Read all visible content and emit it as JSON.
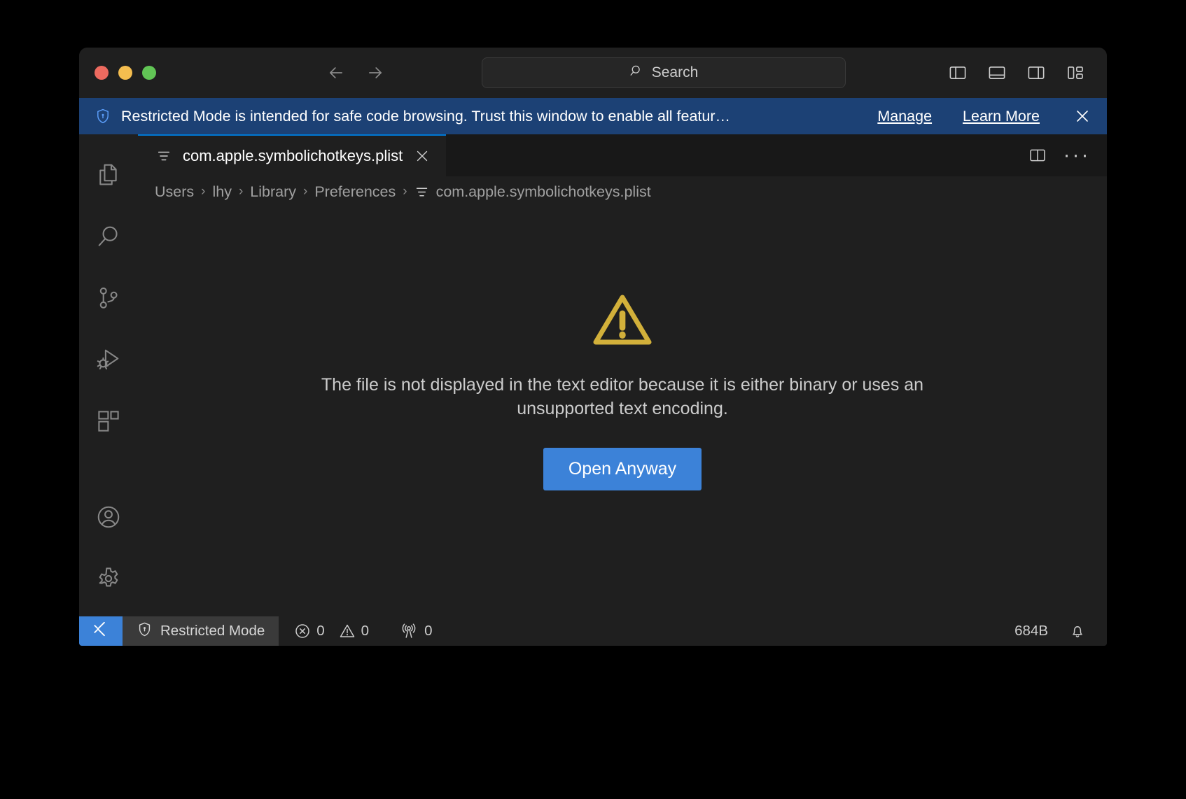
{
  "titlebar": {
    "traffic": [
      "close",
      "minimize",
      "maximize"
    ],
    "back_label": "Back",
    "forward_label": "Forward",
    "search_placeholder": "Search",
    "search_value": "Search",
    "layout_buttons": [
      "toggle-primary-sidebar",
      "toggle-panel",
      "toggle-secondary-sidebar",
      "customize-layout"
    ]
  },
  "banner": {
    "icon": "shield-icon",
    "message": "Restricted Mode is intended for safe code browsing. Trust this window to enable all featur…",
    "manage_label": "Manage",
    "learn_more_label": "Learn More",
    "close_label": "Close"
  },
  "activitybar": {
    "items": [
      {
        "name": "explorer",
        "icon": "files-icon"
      },
      {
        "name": "search",
        "icon": "search-icon"
      },
      {
        "name": "source-control",
        "icon": "source-control-icon"
      },
      {
        "name": "run-and-debug",
        "icon": "debug-icon"
      },
      {
        "name": "extensions",
        "icon": "extensions-icon"
      }
    ],
    "bottom_items": [
      {
        "name": "accounts",
        "icon": "account-icon"
      },
      {
        "name": "manage",
        "icon": "gear-icon"
      }
    ]
  },
  "editor": {
    "tab": {
      "icon": "file-list-icon",
      "label": "com.apple.symbolichotkeys.plist",
      "close_label": "Close tab",
      "active": true
    },
    "tab_actions": [
      "split-editor-icon",
      "more-actions-icon"
    ],
    "more_actions_glyph": "···",
    "breadcrumbs": [
      {
        "label": "Users",
        "icon": null
      },
      {
        "label": "lhy",
        "icon": null
      },
      {
        "label": "Library",
        "icon": null
      },
      {
        "label": "Preferences",
        "icon": null
      },
      {
        "label": "com.apple.symbolichotkeys.plist",
        "icon": "file-list-icon"
      }
    ],
    "breadcrumb_separator": "›",
    "warning_icon": "warning-triangle-icon",
    "message": "The file is not displayed in the text editor because it is either binary or uses an unsupported text encoding.",
    "open_button_label": "Open Anyway"
  },
  "statusbar": {
    "remote_icon": "remote-window-icon",
    "trust_icon": "shield-icon",
    "trust_label": "Restricted Mode",
    "errors_icon": "error-icon",
    "errors_count": "0",
    "warnings_icon": "warning-icon",
    "warnings_count": "0",
    "ports_icon": "radio-tower-icon",
    "ports_count": "0",
    "file_size": "684B",
    "bell_icon": "bell-icon"
  },
  "colors": {
    "accent": "#3c82d8",
    "banner_bg": "#1c4175",
    "tab_active_border": "#0078d4",
    "warning": "#d2b03a"
  }
}
